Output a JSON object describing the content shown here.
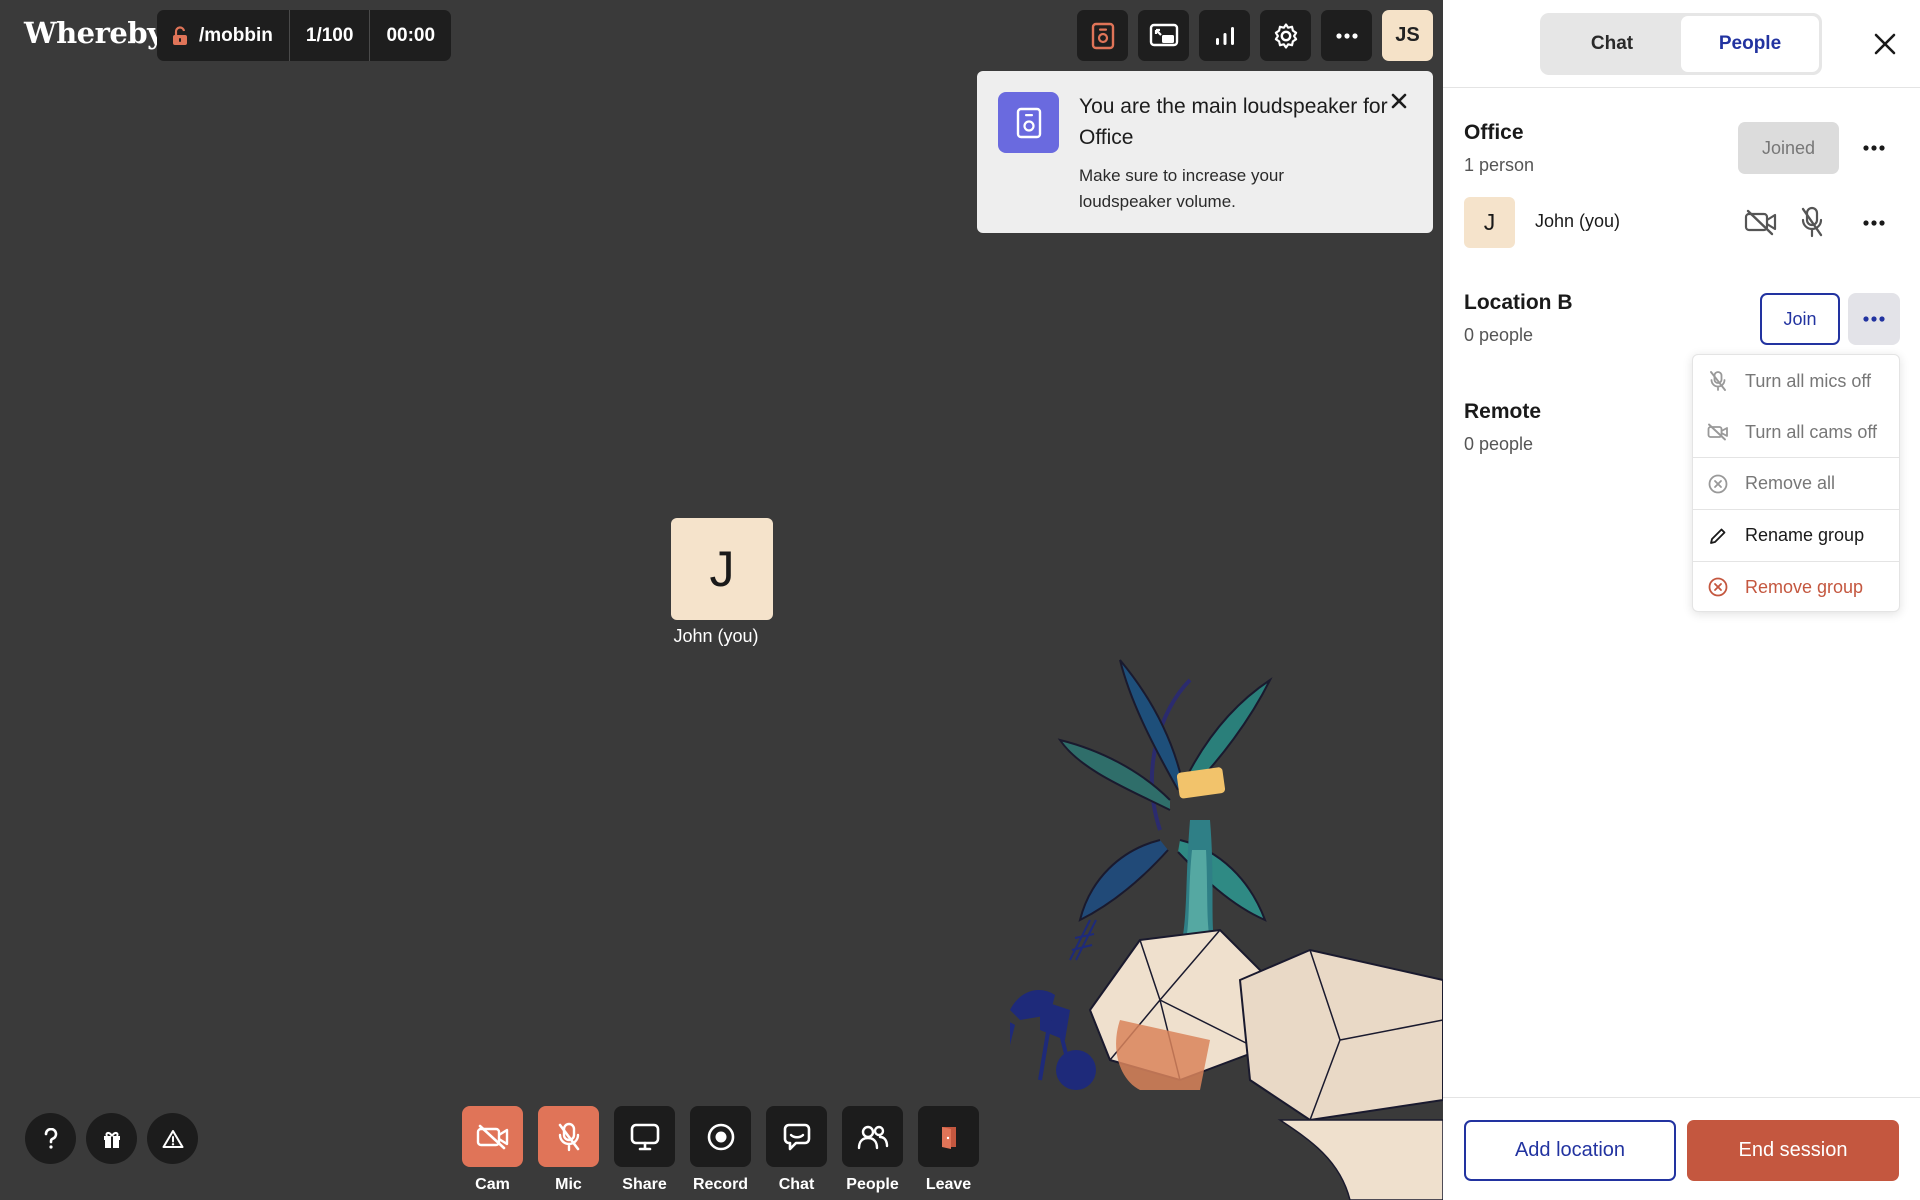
{
  "app": {
    "logo": "Whereby"
  },
  "room": {
    "name": "/mobbin",
    "occupancy": "1/100",
    "timer": "00:00"
  },
  "topbar": {
    "icons": [
      "loudspeaker-icon",
      "picture-in-picture-icon",
      "stats-icon",
      "gear-icon",
      "more-icon"
    ],
    "user_initials": "JS"
  },
  "toast": {
    "title": "You are the main loudspeaker for Office",
    "body": "Make sure to increase your loudspeaker volume."
  },
  "self_view": {
    "initial": "J",
    "name": "John (you)"
  },
  "help_buttons": [
    "help-icon",
    "gift-icon",
    "warning-icon"
  ],
  "controls": [
    {
      "label": "Cam",
      "icon": "camera-off-icon",
      "state": "off"
    },
    {
      "label": "Mic",
      "icon": "mic-off-icon",
      "state": "off"
    },
    {
      "label": "Share",
      "icon": "screen-share-icon",
      "state": "normal"
    },
    {
      "label": "Record",
      "icon": "record-icon",
      "state": "normal"
    },
    {
      "label": "Chat",
      "icon": "chat-icon",
      "state": "normal"
    },
    {
      "label": "People",
      "icon": "people-icon",
      "state": "normal"
    },
    {
      "label": "Leave",
      "icon": "leave-icon",
      "state": "normal"
    }
  ],
  "panel": {
    "tabs": [
      {
        "label": "Chat",
        "active": false
      },
      {
        "label": "People",
        "active": true
      }
    ],
    "groups": [
      {
        "title": "Office",
        "count": "1 person",
        "action": "Joined",
        "members": [
          {
            "initial": "J",
            "name": "John (you)",
            "cam": "off",
            "mic": "off"
          }
        ]
      },
      {
        "title": "Location B",
        "count": "0 people",
        "action": "Join"
      },
      {
        "title": "Remote",
        "count": "0 people"
      }
    ],
    "group_menu": [
      {
        "label": "Turn all mics off",
        "icon": "mic-off-icon",
        "style": "muted"
      },
      {
        "label": "Turn all cams off",
        "icon": "camera-off-icon",
        "style": "muted"
      },
      {
        "label": "Remove all",
        "icon": "remove-circle-icon",
        "style": "muted"
      },
      {
        "label": "Rename group",
        "icon": "pencil-icon",
        "style": "normal"
      },
      {
        "label": "Remove group",
        "icon": "remove-circle-icon",
        "style": "danger"
      }
    ],
    "footer": {
      "add_location": "Add location",
      "end_session": "End session"
    }
  },
  "colors": {
    "stage_bg": "#3a3a3a",
    "control_bg": "#1c1c1c",
    "control_off": "#e07458",
    "accent_blue": "#2233a0",
    "loudspeaker_purple": "#6a6adf",
    "danger": "#c4573f",
    "avatar_bg": "#f5e3cb"
  }
}
